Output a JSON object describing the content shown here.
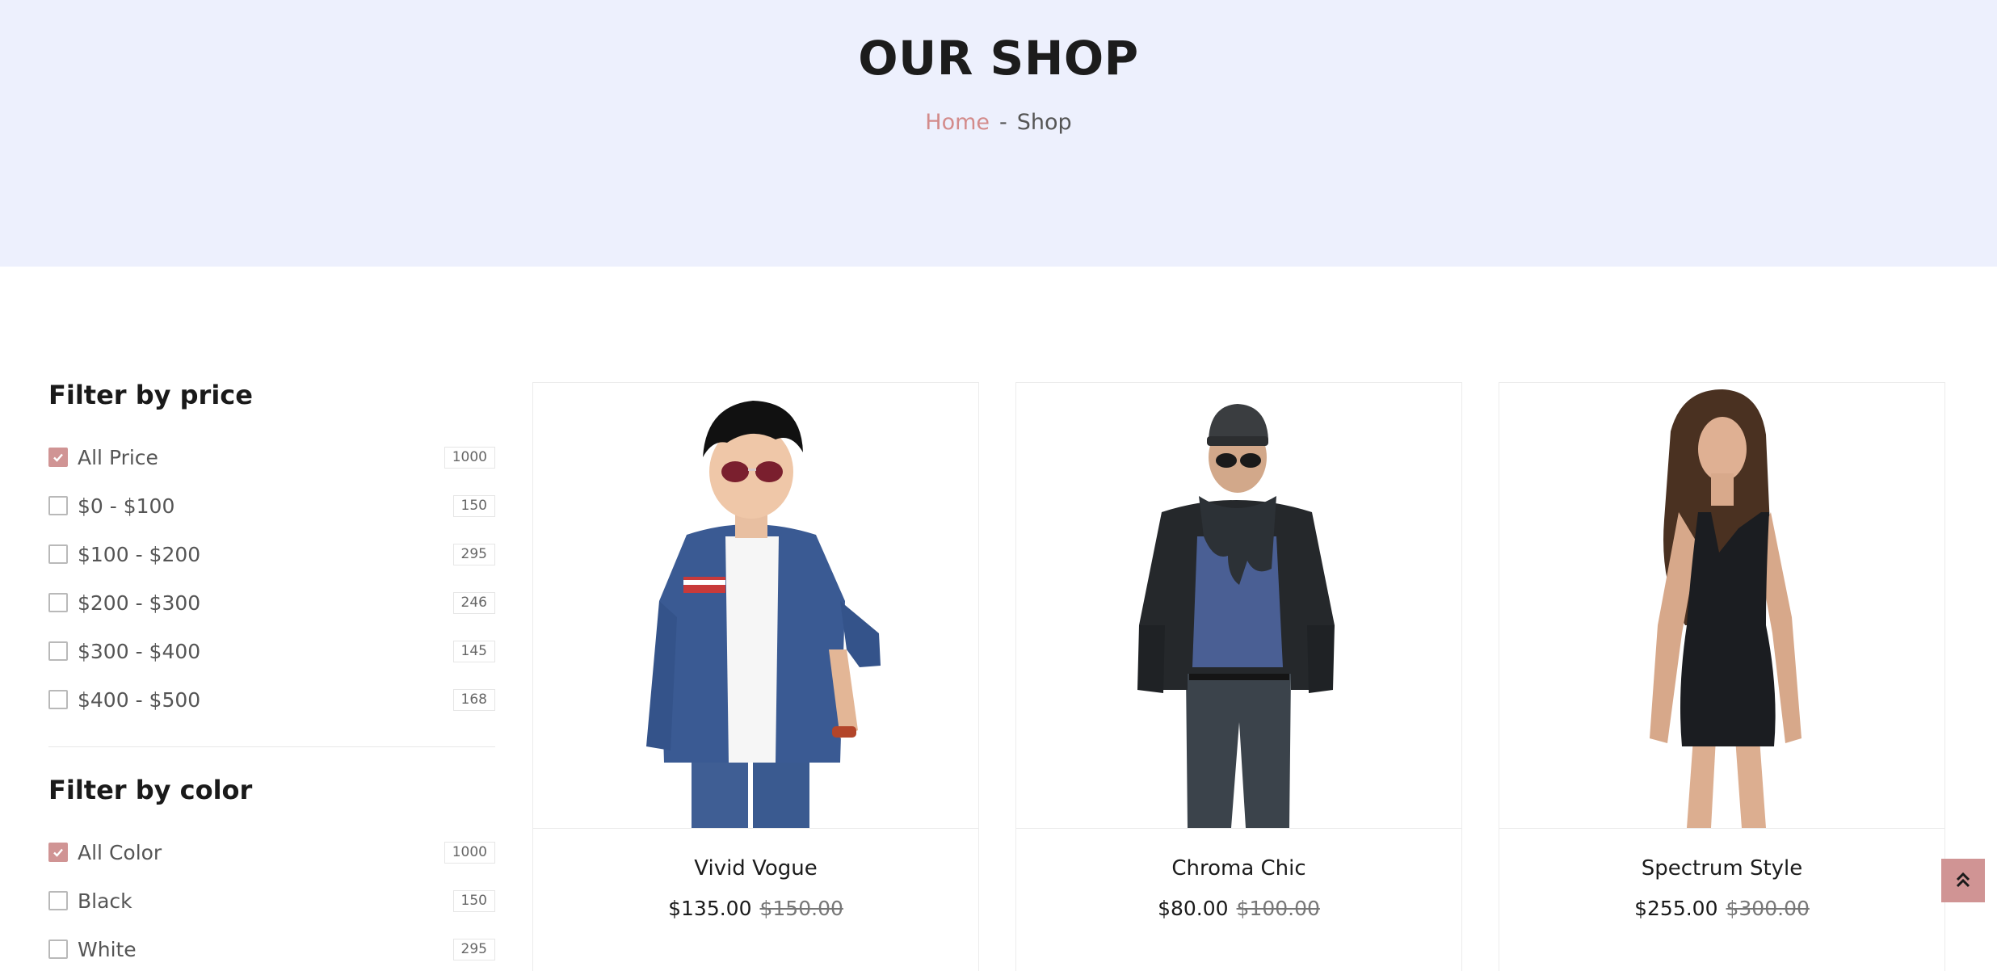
{
  "hero": {
    "title": "OUR SHOP",
    "breadcrumb": {
      "home": "Home",
      "separator": "-",
      "current": "Shop"
    }
  },
  "filters": {
    "price": {
      "title": "Filter by price",
      "items": [
        {
          "label": "All Price",
          "count": "1000",
          "checked": true
        },
        {
          "label": "$0 - $100",
          "count": "150",
          "checked": false
        },
        {
          "label": "$100 - $200",
          "count": "295",
          "checked": false
        },
        {
          "label": "$200 - $300",
          "count": "246",
          "checked": false
        },
        {
          "label": "$300 - $400",
          "count": "145",
          "checked": false
        },
        {
          "label": "$400 - $500",
          "count": "168",
          "checked": false
        }
      ]
    },
    "color": {
      "title": "Filter by color",
      "items": [
        {
          "label": "All Color",
          "count": "1000",
          "checked": true
        },
        {
          "label": "Black",
          "count": "150",
          "checked": false
        },
        {
          "label": "White",
          "count": "295",
          "checked": false
        }
      ]
    }
  },
  "products": [
    {
      "name": "Vivid Vogue",
      "price": "$135.00",
      "old_price": "$150.00",
      "image": "boy-denim-jacket-photo"
    },
    {
      "name": "Chroma Chic",
      "price": "$80.00",
      "old_price": "$100.00",
      "image": "man-leather-jacket-scarf-photo"
    },
    {
      "name": "Spectrum Style",
      "price": "$255.00",
      "old_price": "$300.00",
      "image": "woman-black-dress-photo"
    }
  ],
  "icons": {
    "check": "check-icon",
    "scroll_top": "double-chevron-up-icon"
  },
  "colors": {
    "accent": "#d09494",
    "hero_bg": "#edf0fd",
    "breadcrumb_home": "#d38b8b"
  }
}
